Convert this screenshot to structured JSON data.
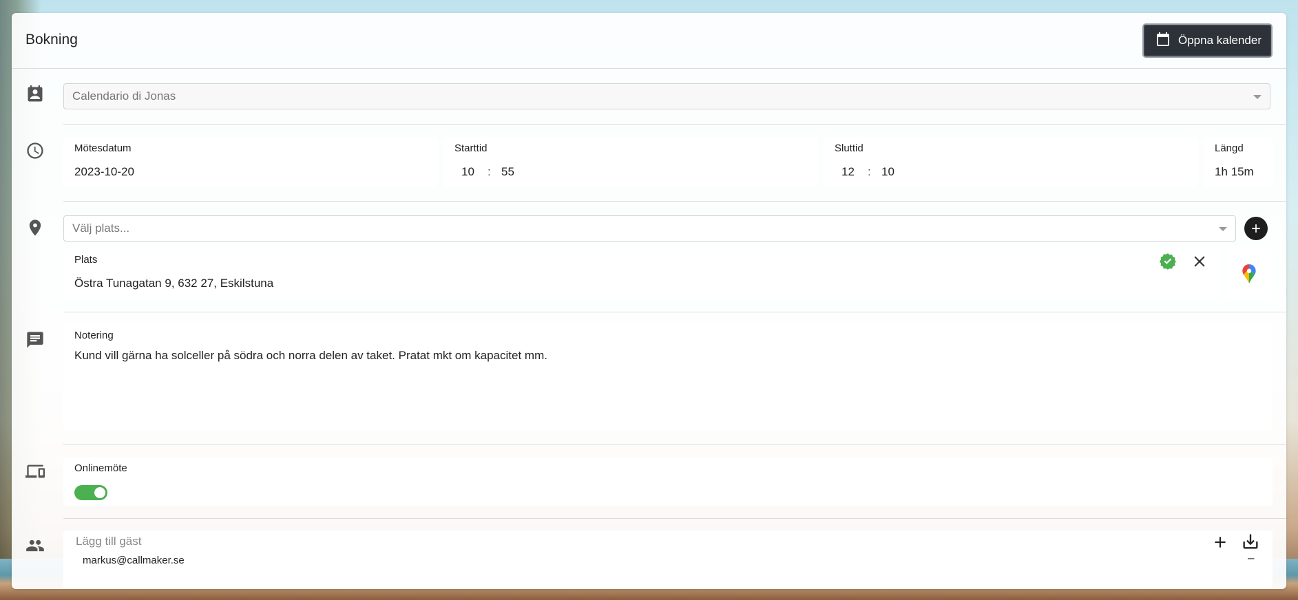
{
  "header": {
    "title": "Bokning",
    "open_calendar_label": "Öppna kalender"
  },
  "calendar_select": {
    "value": "Calendario di Jonas"
  },
  "time": {
    "date_label": "Mötesdatum",
    "date_value": "2023-10-20",
    "start_label": "Starttid",
    "start_hour": "10",
    "start_minute": "55",
    "end_label": "Sluttid",
    "end_hour": "12",
    "end_minute": "10",
    "separator": ":",
    "length_label": "Längd",
    "length_value": "1h 15m"
  },
  "location": {
    "placeholder": "Välj plats...",
    "place_label": "Plats",
    "place_value": "Östra Tunagatan 9, 632 27, Eskilstuna"
  },
  "note": {
    "label": "Notering",
    "value": "Kund vill gärna ha solceller på södra och norra delen av taket. Pratat mkt om kapacitet mm."
  },
  "online": {
    "label": "Onlinemöte",
    "enabled": true
  },
  "guests": {
    "placeholder": "Lägg till gäst",
    "items": [
      "markus@callmaker.se"
    ],
    "remove_glyph": "–"
  },
  "colors": {
    "primary_dark": "#2d3238",
    "toggle_on": "#4caf50",
    "verified": "#4caf50"
  },
  "icons": {
    "calendar": "calendar-icon",
    "contact": "contact-card-icon",
    "clock": "clock-icon",
    "pin": "location-pin-icon",
    "note": "comment-icon",
    "devices": "devices-icon",
    "people": "people-icon"
  }
}
